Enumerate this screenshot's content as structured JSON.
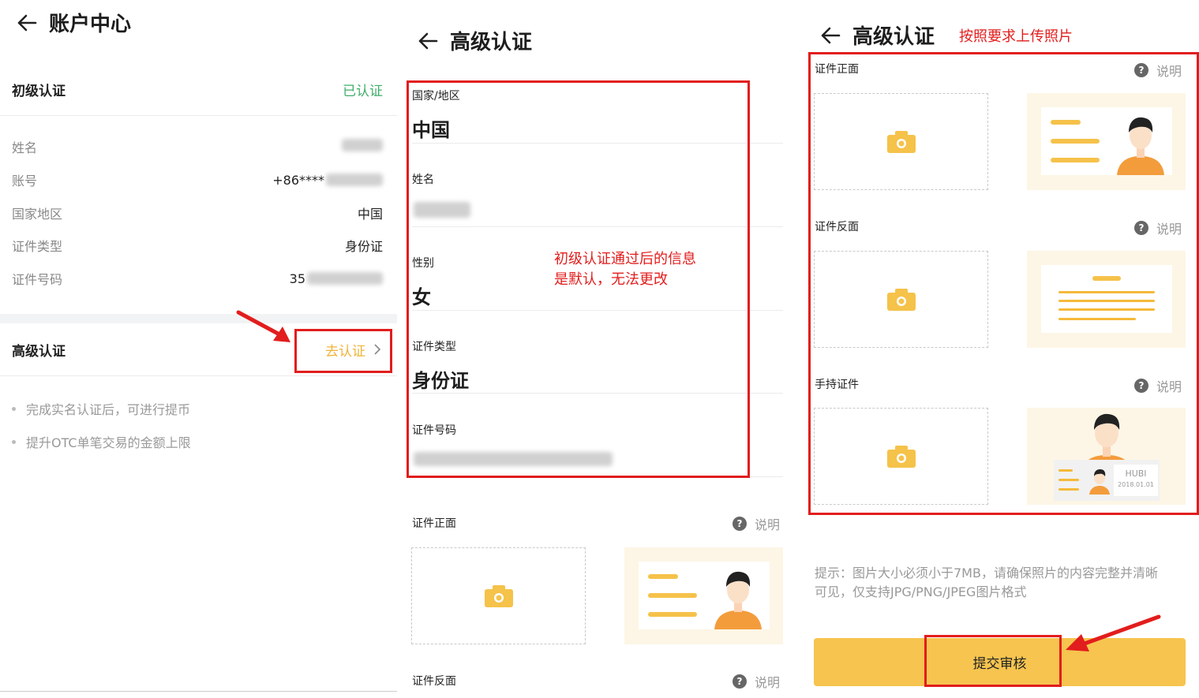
{
  "left": {
    "title": "账户中心",
    "basic": {
      "label": "初级认证",
      "status": "已认证"
    },
    "info": [
      {
        "label": "姓名",
        "value": ""
      },
      {
        "label": "账号",
        "value": "+86****"
      },
      {
        "label": "国家地区",
        "value": "中国"
      },
      {
        "label": "证件类型",
        "value": "身份证"
      },
      {
        "label": "证件号码",
        "value": "35"
      }
    ],
    "advanced": {
      "label": "高级认证",
      "action": "去认证"
    },
    "bullets": [
      "完成实名认证后，可进行提币",
      "提升OTC单笔交易的金额上限"
    ]
  },
  "middle": {
    "title": "高级认证",
    "fields": [
      {
        "label": "国家/地区",
        "value": "中国"
      },
      {
        "label": "姓名",
        "value": ""
      },
      {
        "label": "性别",
        "value": "女"
      },
      {
        "label": "证件类型",
        "value": "身份证"
      },
      {
        "label": "证件号码",
        "value": ""
      }
    ],
    "annotation": [
      "初级认证通过后的信息",
      "是默认，无法更改"
    ],
    "sections": [
      {
        "label": "证件正面",
        "help": "说明"
      },
      {
        "label": "证件反面",
        "help": "说明"
      }
    ]
  },
  "right": {
    "title": "高级认证",
    "annotation": "按照要求上传照片",
    "sections": [
      {
        "label": "证件正面",
        "help": "说明"
      },
      {
        "label": "证件反面",
        "help": "说明"
      },
      {
        "label": "手持证件",
        "help": "说明"
      }
    ],
    "sample_card": {
      "brand": "HUBI",
      "date": "2018.01.01"
    },
    "note": [
      "提示：图片大小必须小于7MB，请确保照片的内容完整并清晰",
      "可见，仅支持JPG/PNG/JPEG图片格式"
    ],
    "submit": "提交审核"
  },
  "colors": {
    "accent": "#f6c44f",
    "verified": "#3fae6a",
    "annotation": "#e21d1d",
    "pending": "#f0b43c"
  }
}
